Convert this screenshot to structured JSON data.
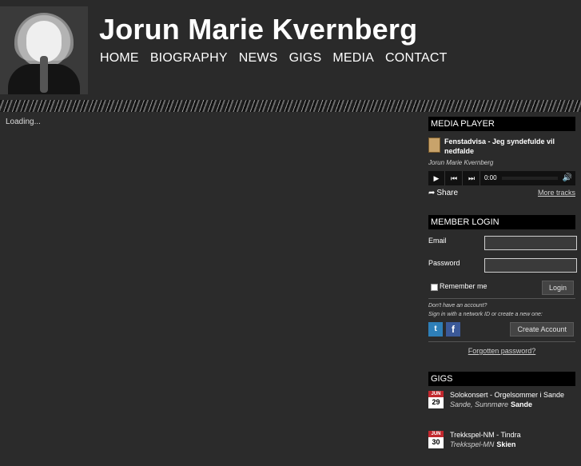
{
  "site": {
    "title": "Jorun Marie Kvernberg",
    "nav": [
      "HOME",
      "BIOGRAPHY",
      "NEWS",
      "GIGS",
      "MEDIA",
      "CONTACT"
    ]
  },
  "main": {
    "loading_text": "Loading..."
  },
  "media_player": {
    "heading": "MEDIA PLAYER",
    "track_title": "Fenstadvisa - Jeg syndefulde vil nedfalde",
    "artist": "Jorun Marie Kvernberg",
    "time": "0:00",
    "share_label": "Share",
    "more_tracks_label": "More tracks"
  },
  "member_login": {
    "heading": "MEMBER LOGIN",
    "email_label": "Email",
    "password_label": "Password",
    "remember_label": "Remember me",
    "login_button": "Login",
    "no_account_note": "Don't have an account?",
    "signin_note": "Sign in with a network ID or create a new one:",
    "create_account_button": "Create Account",
    "forgot_link": "Forgotten password?"
  },
  "gigs": {
    "heading": "GIGS",
    "items": [
      {
        "month": "JUN",
        "day": "29",
        "name": "Solokonsert - Orgelsommer i Sande",
        "location": "Sande, Sunnmøre",
        "city": "Sande"
      },
      {
        "month": "JUN",
        "day": "30",
        "name": "Trekkspel-NM - Tindra",
        "location": "Trekkspel-MN",
        "city": "Skien"
      }
    ]
  },
  "colors": {
    "background": "#2b2b2b",
    "box_heading": "#000000",
    "date_red": "#c1272d"
  }
}
